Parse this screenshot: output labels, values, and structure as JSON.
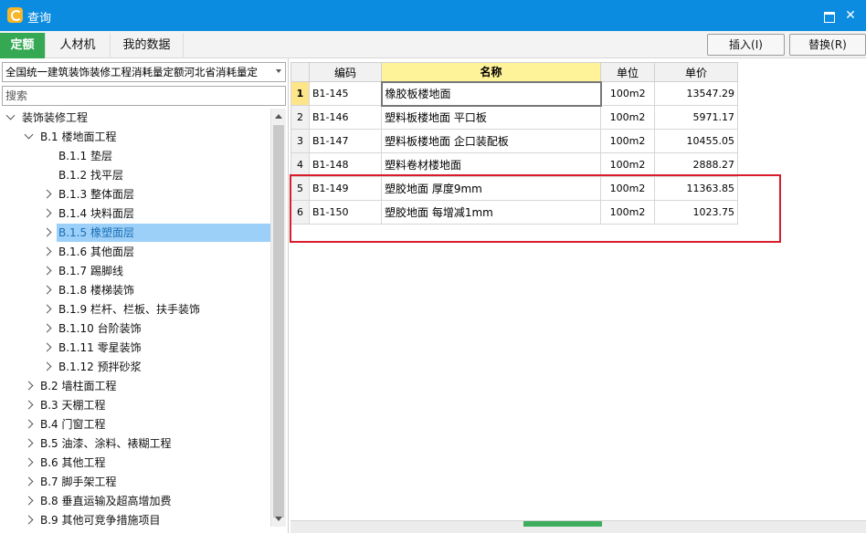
{
  "window": {
    "title": "查询"
  },
  "tabs": [
    {
      "label": "定额",
      "active": true
    },
    {
      "label": "人材机",
      "active": false
    },
    {
      "label": "我的数据",
      "active": false
    }
  ],
  "toolbar": {
    "insert_label": "插入(I)",
    "replace_label": "替换(R)"
  },
  "library_select": {
    "value": "全国统一建筑装饰装修工程消耗量定额河北省消耗量定"
  },
  "search": {
    "placeholder": "搜索"
  },
  "tree": [
    {
      "label": "装饰装修工程",
      "level": 0,
      "expander": "down"
    },
    {
      "label": "B.1 楼地面工程",
      "level": 1,
      "expander": "down"
    },
    {
      "label": "B.1.1 垫层",
      "level": 2,
      "expander": "none"
    },
    {
      "label": "B.1.2 找平层",
      "level": 2,
      "expander": "none"
    },
    {
      "label": "B.1.3 整体面层",
      "level": 2,
      "expander": "right"
    },
    {
      "label": "B.1.4 块料面层",
      "level": 2,
      "expander": "right"
    },
    {
      "label": "B.1.5 橡塑面层",
      "level": 2,
      "expander": "right",
      "selected": true
    },
    {
      "label": "B.1.6 其他面层",
      "level": 2,
      "expander": "right"
    },
    {
      "label": "B.1.7 踢脚线",
      "level": 2,
      "expander": "right"
    },
    {
      "label": "B.1.8 楼梯装饰",
      "level": 2,
      "expander": "right"
    },
    {
      "label": "B.1.9 栏杆、栏板、扶手装饰",
      "level": 2,
      "expander": "right"
    },
    {
      "label": "B.1.10 台阶装饰",
      "level": 2,
      "expander": "right"
    },
    {
      "label": "B.1.11 零星装饰",
      "level": 2,
      "expander": "right"
    },
    {
      "label": "B.1.12 预拌砂浆",
      "level": 2,
      "expander": "right"
    },
    {
      "label": "B.2 墙柱面工程",
      "level": 1,
      "expander": "right"
    },
    {
      "label": "B.3 天棚工程",
      "level": 1,
      "expander": "right"
    },
    {
      "label": "B.4 门窗工程",
      "level": 1,
      "expander": "right"
    },
    {
      "label": "B.5 油漆、涂料、裱糊工程",
      "level": 1,
      "expander": "right"
    },
    {
      "label": "B.6 其他工程",
      "level": 1,
      "expander": "right"
    },
    {
      "label": "B.7 脚手架工程",
      "level": 1,
      "expander": "right"
    },
    {
      "label": "B.8 垂直运输及超高增加费",
      "level": 1,
      "expander": "right"
    },
    {
      "label": "B.9 其他可竞争措施项目",
      "level": 1,
      "expander": "right"
    }
  ],
  "table": {
    "headers": [
      "编码",
      "名称",
      "单位",
      "单价"
    ],
    "rows": [
      {
        "no": "1",
        "code": "B1-145",
        "name": "橡胶板楼地面",
        "unit": "100m2",
        "price": "13547.29",
        "current": true
      },
      {
        "no": "2",
        "code": "B1-146",
        "name": "塑料板楼地面 平口板",
        "unit": "100m2",
        "price": "5971.17"
      },
      {
        "no": "3",
        "code": "B1-147",
        "name": "塑料板楼地面 企口装配板",
        "unit": "100m2",
        "price": "10455.05"
      },
      {
        "no": "4",
        "code": "B1-148",
        "name": "塑料卷材楼地面",
        "unit": "100m2",
        "price": "2888.27"
      },
      {
        "no": "5",
        "code": "B1-149",
        "name": "塑胶地面 厚度9mm",
        "unit": "100m2",
        "price": "11363.85"
      },
      {
        "no": "6",
        "code": "B1-150",
        "name": "塑胶地面 每增减1mm",
        "unit": "100m2",
        "price": "1023.75"
      }
    ]
  },
  "colors": {
    "titlebar": "#0c8ce0",
    "active_tab": "#34a853",
    "selection": "#9dd0f8",
    "name_header": "#fff39a",
    "highlight_box": "#d91c2c"
  }
}
